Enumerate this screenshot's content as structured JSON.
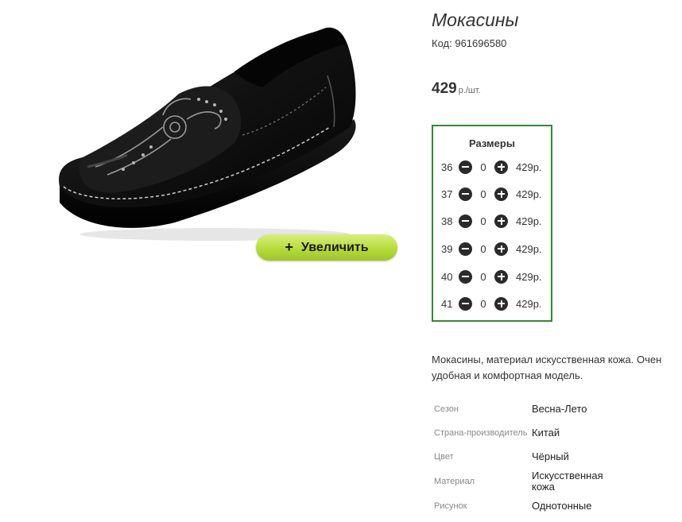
{
  "product": {
    "title": "Мокасины",
    "sku_label": "Код:",
    "sku": "961696580",
    "price": "429",
    "price_unit": "р./шт.",
    "zoom_label": "Увеличить",
    "zoom_icon": "plus-icon"
  },
  "sizes": {
    "title": "Размеры",
    "rows": [
      {
        "size": "36",
        "qty": "0",
        "price": "429р."
      },
      {
        "size": "37",
        "qty": "0",
        "price": "429р."
      },
      {
        "size": "38",
        "qty": "0",
        "price": "429р."
      },
      {
        "size": "39",
        "qty": "0",
        "price": "429р."
      },
      {
        "size": "40",
        "qty": "0",
        "price": "429р."
      },
      {
        "size": "41",
        "qty": "0",
        "price": "429р."
      }
    ]
  },
  "description": "Мокасины, материал искусственная кожа. Очен удобная и комфортная модель.",
  "attributes": [
    {
      "name": "Сезон",
      "value": "Весна-Лето"
    },
    {
      "name": "Страна-производитель",
      "value": "Китай"
    },
    {
      "name": "Цвет",
      "value": "Чёрный"
    },
    {
      "name": "Материал",
      "value": "Искусственная кожа"
    },
    {
      "name": "Рисунок",
      "value": "Однотонные"
    }
  ],
  "colors": {
    "accent_border": "#2e8b2e",
    "button_green": "#b6dc3a"
  }
}
